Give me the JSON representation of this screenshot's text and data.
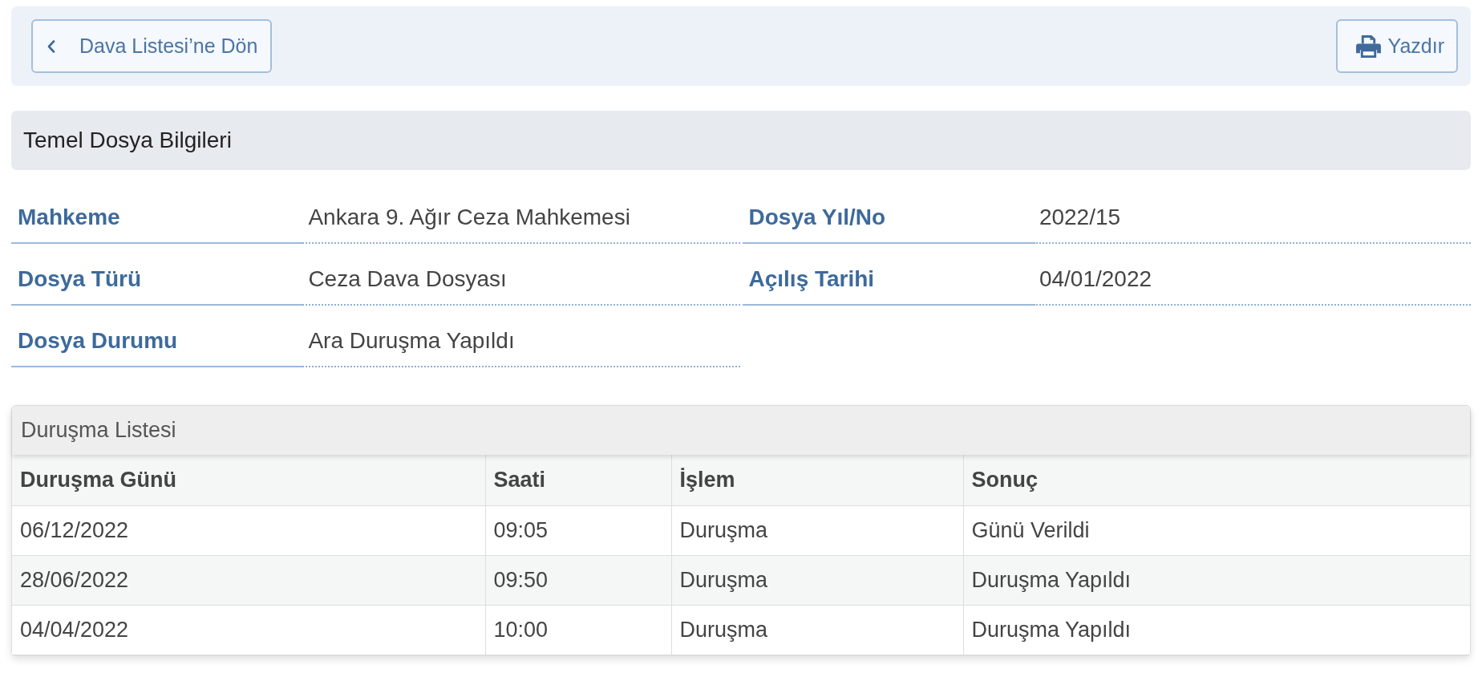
{
  "toolbar": {
    "back_button": "Dava Listesi’ne Dön",
    "print_button": "Yazdır"
  },
  "file_info": {
    "title": "Temel Dosya Bilgileri",
    "fields": [
      {
        "label": "Mahkeme",
        "value": "Ankara 9. Ağır Ceza Mahkemesi"
      },
      {
        "label": "Dosya Yıl/No",
        "value": "2022/15"
      },
      {
        "label": "Dosya Türü",
        "value": "Ceza Dava Dosyası"
      },
      {
        "label": "Açılış Tarihi",
        "value": "04/01/2022"
      },
      {
        "label": "Dosya Durumu",
        "value": "Ara Duruşma Yapıldı"
      }
    ]
  },
  "hearings": {
    "title": "Duruşma Listesi",
    "columns": [
      "Duruşma Günü",
      "Saati",
      "İşlem",
      "Sonuç"
    ],
    "rows": [
      [
        "06/12/2022",
        "09:05",
        "Duruşma",
        "Günü Verildi"
      ],
      [
        "28/06/2022",
        "09:50",
        "Duruşma",
        "Duruşma Yapıldı"
      ],
      [
        "04/04/2022",
        "10:00",
        "Duruşma",
        "Duruşma Yapıldı"
      ]
    ]
  }
}
